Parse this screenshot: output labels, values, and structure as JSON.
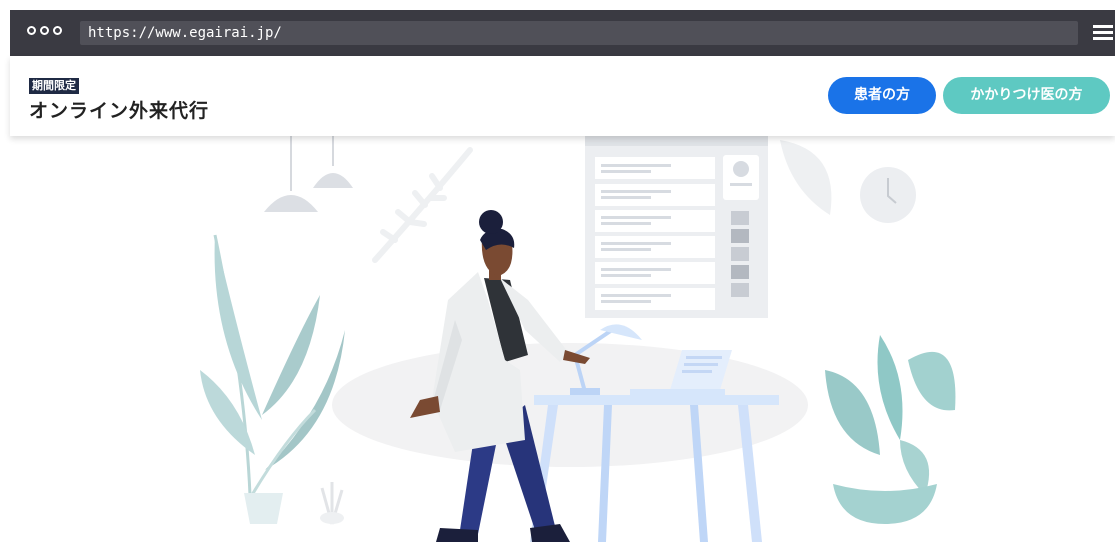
{
  "browser": {
    "url": "https://www.egairai.jp/",
    "icons": [
      "window-controls-icon",
      "hamburger-menu-icon"
    ]
  },
  "header": {
    "badge": "期間限定",
    "title": "オンライン外来代行",
    "nav": {
      "patient_label": "患者の方",
      "doctor_label": "かかりつけ医の方"
    }
  },
  "colors": {
    "patient_button": "#1a73e8",
    "doctor_button": "#5ec9c2",
    "badge_bg": "#1f2a44",
    "browser_chrome": "#3a3a42"
  }
}
